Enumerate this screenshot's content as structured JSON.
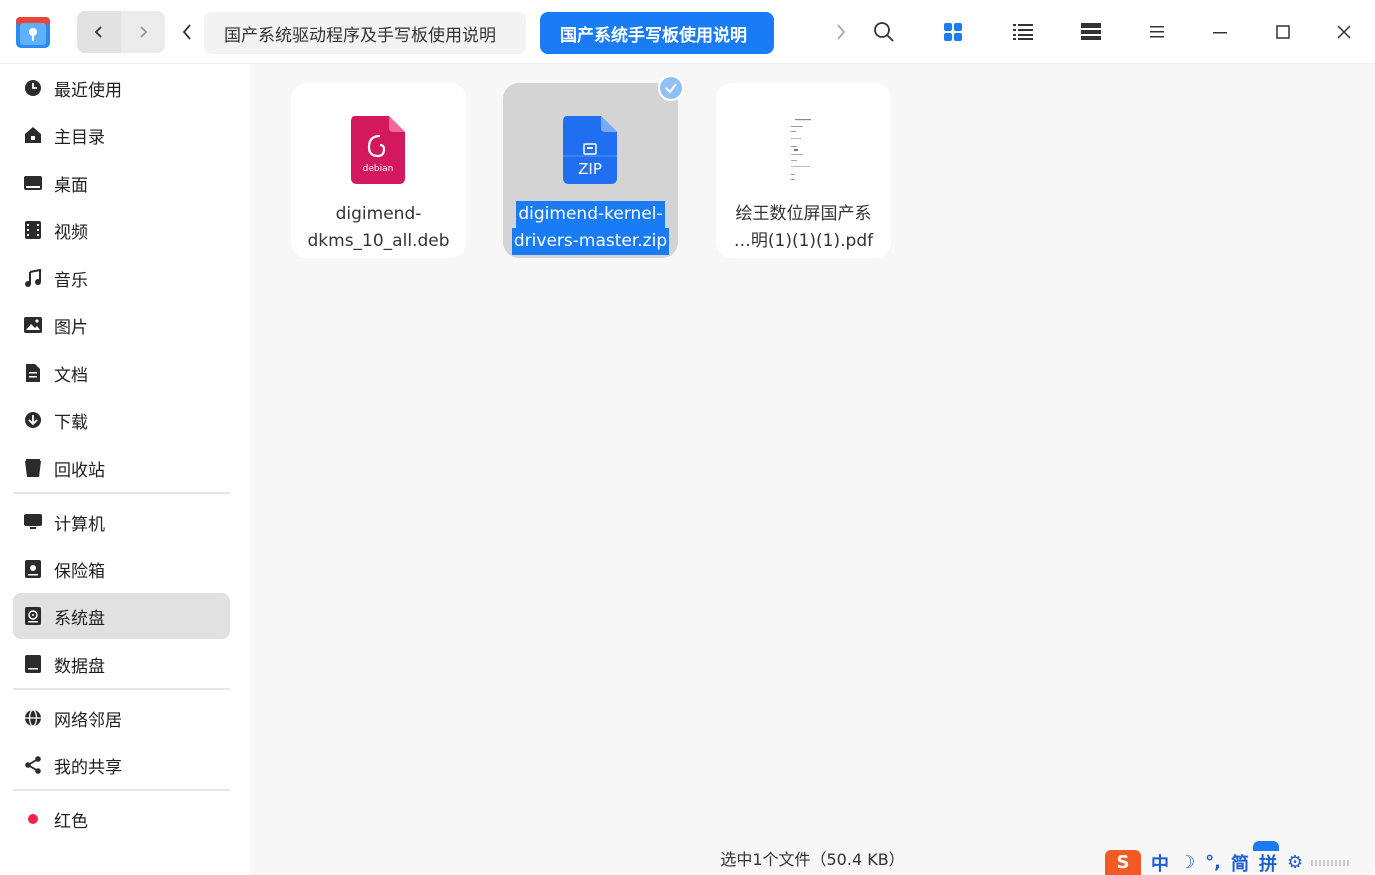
{
  "titlebar": {
    "breadcrumbs": [
      "国产系统驱动程序及手写板使用说明",
      "国产系统手写板使用说明"
    ]
  },
  "sidebar": {
    "items": [
      {
        "label": "最近使用",
        "icon": "clock-icon"
      },
      {
        "label": "主目录",
        "icon": "home-icon"
      },
      {
        "label": "桌面",
        "icon": "desktop-icon"
      },
      {
        "label": "视频",
        "icon": "video-icon"
      },
      {
        "label": "音乐",
        "icon": "music-icon"
      },
      {
        "label": "图片",
        "icon": "picture-icon"
      },
      {
        "label": "文档",
        "icon": "document-icon"
      },
      {
        "label": "下载",
        "icon": "download-icon"
      },
      {
        "label": "回收站",
        "icon": "trash-icon"
      },
      {
        "label": "计算机",
        "icon": "computer-icon"
      },
      {
        "label": "保险箱",
        "icon": "vault-icon"
      },
      {
        "label": "系统盘",
        "icon": "system-disk-icon",
        "active": true
      },
      {
        "label": "数据盘",
        "icon": "data-disk-icon"
      },
      {
        "label": "网络邻居",
        "icon": "network-icon"
      },
      {
        "label": "我的共享",
        "icon": "share-icon"
      },
      {
        "label": "红色",
        "icon": "red-tag-icon"
      }
    ]
  },
  "files": [
    {
      "line1": "digimend-",
      "line2": "dkms_10_all.deb",
      "type": "debian",
      "icon_text": "debian"
    },
    {
      "line1": "digimend-kernel-",
      "line2": "drivers-master.zip",
      "type": "zip",
      "icon_text": "ZIP",
      "selected": true
    },
    {
      "line1": "绘王数位屏国产系",
      "line2": "…明(1)(1)(1).pdf",
      "type": "pdf"
    }
  ],
  "status": {
    "text": "选中1个文件（50.4 KB）"
  },
  "ime": {
    "logo": "S",
    "items": [
      "中",
      "☽",
      "°,",
      "简",
      "拼",
      "⚙"
    ]
  },
  "colors": {
    "accent": "#1a7cf5",
    "debian": "#d3185b",
    "zip": "#1f6ff0",
    "selection_bg": "#d4d4d4"
  }
}
